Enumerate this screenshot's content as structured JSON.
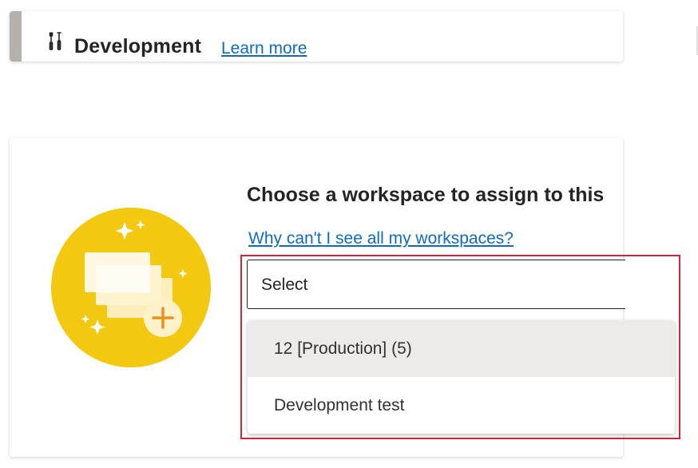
{
  "stage": {
    "icon": "tools-icon",
    "title": "Development",
    "learn_more": "Learn more"
  },
  "assign": {
    "heading": "Choose a workspace to assign to this",
    "why_link": "Why can't I see all my workspaces?",
    "select": {
      "value": "Select"
    },
    "options": [
      {
        "label": "12 [Production] (5)",
        "state": "highlighted"
      },
      {
        "label": "Development test"
      }
    ],
    "illustration": "add-workspace-illustration"
  },
  "colors": {
    "link": "#0f6cbd",
    "highlight_border": "#d0263d",
    "stage_accent": "#b3b0ad",
    "illustration_circle": "#f2c811",
    "selected_option_bg": "#edebe9"
  }
}
